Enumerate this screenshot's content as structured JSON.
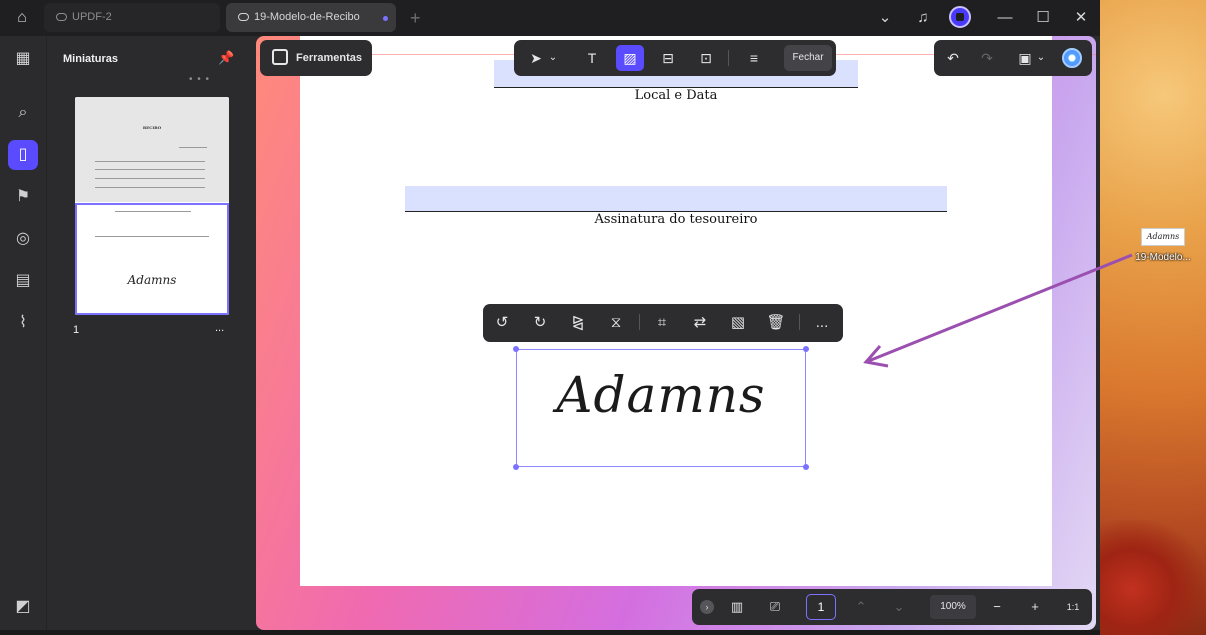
{
  "desktop": {
    "file_icon_thumb": "Adamns",
    "file_icon_label": "19-Modelo...",
    "arrow_color": "#9b4fb0"
  },
  "titlebar": {
    "tabs": [
      {
        "label": "UPDF-2"
      },
      {
        "label": "19-Modelo-de-Recibo"
      }
    ],
    "icons": [
      "home-icon",
      "chevron-down-icon",
      "bell-icon",
      "avatar",
      "minimize-icon",
      "maximize-icon",
      "close-icon"
    ]
  },
  "rail": {
    "items": [
      "apps-icon",
      "search-icon",
      "pages-icon",
      "bookmark-icon",
      "comment-icon",
      "attachment-file-icon",
      "paperclip-icon",
      "layers-icon"
    ],
    "active_index": 2
  },
  "thumbnails": {
    "title": "Miniaturas",
    "page_label": "1",
    "more_label": "...",
    "thumb_title": "RECIBO",
    "thumb_signature": "Adamns"
  },
  "toolbar": {
    "tools_label": "Ferramentas",
    "close_label": "Fechar",
    "active_tool": "image-tool"
  },
  "document": {
    "label_local_data": "Local e Data",
    "label_treasurer": "Assinatura do tesoureiro",
    "signature_text": "Adamns"
  },
  "image_toolbar": {
    "more_label": "..."
  },
  "bottom": {
    "page_number": "1",
    "zoom": "100%",
    "fit_label": "1:1"
  },
  "colors": {
    "accent": "#5b4bff",
    "selection": "#7b73ff",
    "field_fill": "#d9e1ff"
  }
}
